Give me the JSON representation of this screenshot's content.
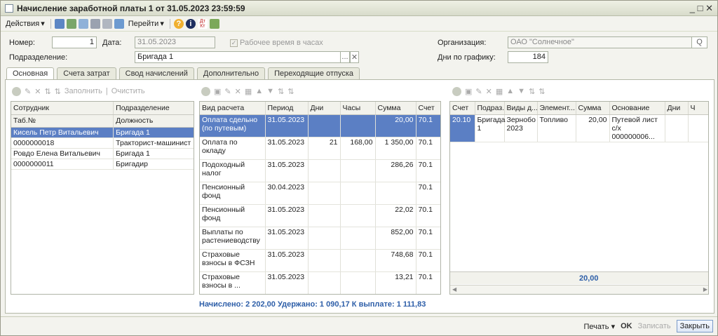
{
  "window": {
    "title": "Начисление заработной платы 1 от 31.05.2023 23:59:59",
    "controls": "_ □ ✕"
  },
  "toolbar": {
    "actions": "Действия",
    "goto": "Перейти",
    "actions_arrow": "▾",
    "goto_arrow": "▾",
    "help": "?",
    "info": "i",
    "dtkt": "Дт Кт"
  },
  "header": {
    "number_label": "Номер:",
    "number_value": "1",
    "date_label": "Дата:",
    "date_value": "31.05.2023",
    "hours_checkbox": "Рабочее время в часах",
    "org_label": "Организация:",
    "org_value": "ОАО \"Солнечное\"",
    "dept_label": "Подразделение:",
    "dept_value": "Бригада 1",
    "days_label": "Дни по графику:",
    "days_value": "184",
    "dots": "...",
    "clear": "✕",
    "search": "Q"
  },
  "tabs": [
    "Основная",
    "Счета затрат",
    "Свод начислений",
    "Дополнительно",
    "Переходящие отпуска"
  ],
  "left_bar": {
    "fill": "Заполнить",
    "clear": "Очистить"
  },
  "employees": {
    "headers": [
      "Сотрудник",
      "Подразделение"
    ],
    "subheaders": [
      "Таб.№",
      "Должность"
    ],
    "rows": [
      [
        "Кисель Петр Витальевич",
        "Бригада 1"
      ],
      [
        "0000000018",
        "Тракторист-машинист"
      ],
      [
        "Ровдо Елена Витальевич",
        "Бригада 1"
      ],
      [
        "0000000011",
        "Бригадир"
      ]
    ]
  },
  "calc": {
    "headers": [
      "Вид расчета",
      "Период",
      "Дни",
      "Часы",
      "Сумма",
      "Счет"
    ],
    "rows": [
      [
        "Оплата сдельно (по путевым)",
        "31.05.2023",
        "",
        "",
        "20,00",
        "70.1"
      ],
      [
        "Оплата по окладу",
        "31.05.2023",
        "21",
        "168,00",
        "1 350,00",
        "70.1"
      ],
      [
        "Подоходный налог",
        "31.05.2023",
        "",
        "",
        "286,26",
        "70.1"
      ],
      [
        "Пенсионный фонд",
        "30.04.2023",
        "",
        "",
        "",
        "70.1"
      ],
      [
        "Пенсионный фонд",
        "31.05.2023",
        "",
        "",
        "22,02",
        "70.1"
      ],
      [
        "Выплаты по растениеводству",
        "31.05.2023",
        "",
        "",
        "852,00",
        "70.1"
      ],
      [
        "Страховые взносы в ФСЗН",
        "31.05.2023",
        "",
        "",
        "748,68",
        "70.1"
      ],
      [
        "Страховые взносы в ...",
        "31.05.2023",
        "",
        "",
        "13,21",
        "70.1"
      ]
    ]
  },
  "costs": {
    "headers": [
      "Счет",
      "Подраз...",
      "Виды д...",
      "Элемент...",
      "Сумма",
      "Основание",
      "Дни",
      "Ч"
    ],
    "rows": [
      [
        "20.10",
        "Бригада 1",
        "Зернобо 2023",
        "Топливо",
        "20,00",
        "Путевой лист с/х 000000006...",
        "",
        ""
      ]
    ],
    "total": "20,00"
  },
  "summary": "Начислено: 2 202,00  Удержано: 1 090,17 К выплате: 1 111,83",
  "footer": {
    "print": "Печать",
    "ok": "OK",
    "save": "Записать",
    "close": "Закрыть"
  }
}
